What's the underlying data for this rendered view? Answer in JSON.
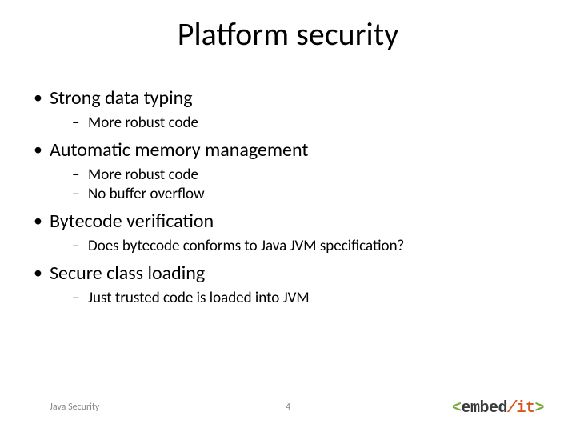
{
  "title": "Platform security",
  "bullets": [
    {
      "label": "Strong data typing",
      "sub": [
        "More robust code"
      ]
    },
    {
      "label": "Automatic memory management",
      "sub": [
        "More robust code",
        "No buffer overflow"
      ]
    },
    {
      "label": "Bytecode verification",
      "sub": [
        "Does bytecode conforms to Java JVM specification?"
      ]
    },
    {
      "label": "Secure class loading",
      "sub": [
        "Just trusted code is loaded into JVM"
      ]
    }
  ],
  "footer": {
    "left": "Java Security",
    "page": "4"
  },
  "logo": {
    "open": "<",
    "word": "embed",
    "slash": "/",
    "it": "it",
    "close": ">"
  }
}
